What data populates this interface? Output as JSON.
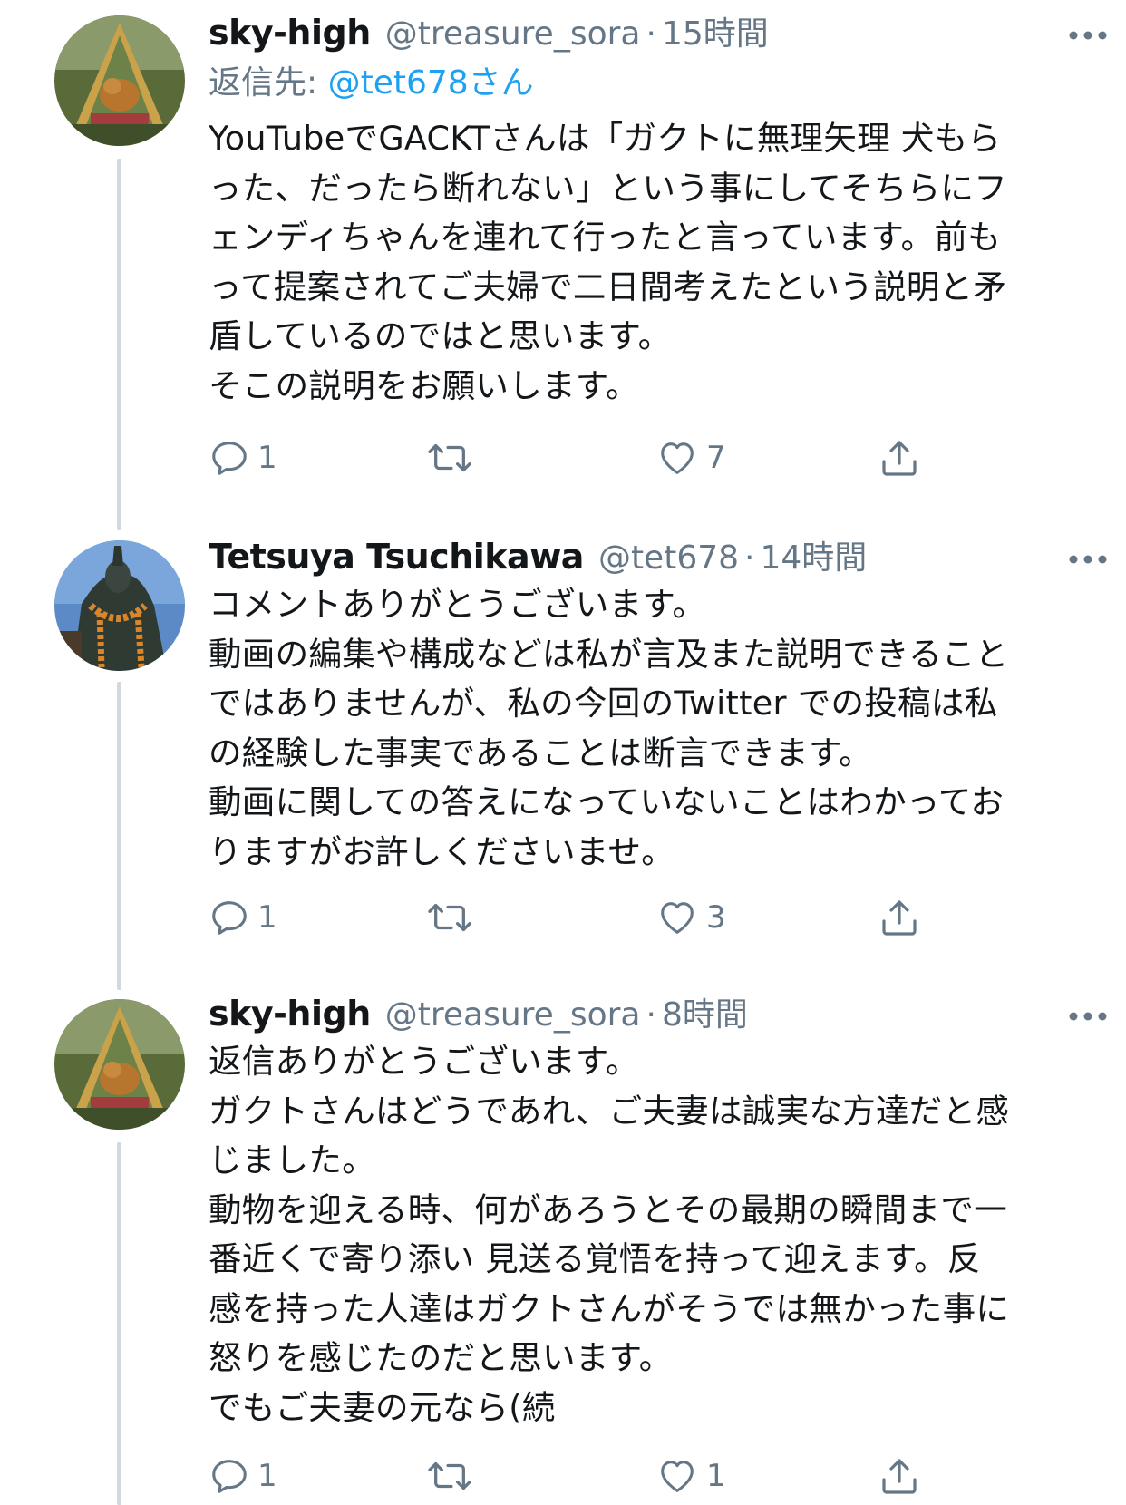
{
  "tweets": [
    {
      "name": "sky-high",
      "handle": "@treasure_sora",
      "separator": "·",
      "time": "15時間",
      "reply_prefix": "返信先: ",
      "reply_mention": "@tet678さん",
      "text": "YouTubeでGACKTさんは「ガクトに無理矢理 犬もら\nった、だったら断れない」という事にしてそちらにフ\nェンディちゃんを連れて行ったと言っています。前も\nって提案されてご夫婦で二日間考えたという説明と矛\n盾しているのではと思います。\nそこの説明をお願いします。",
      "reply_count": "1",
      "retweet_count": "",
      "like_count": "7",
      "avatar_icon": "dog-avatar"
    },
    {
      "name": "Tetsuya Tsuchikawa",
      "handle": "@tet678",
      "separator": "·",
      "time": "14時間",
      "text": "コメントありがとうございます。\n動画の編集や構成などは私が言及また説明できること\nではありませんが、私の今回のTwitter での投稿は私\nの経験した事実であることは断言できます。\n動画に関しての答えになっていないことはわかってお\nりますがお許しくださいませ。",
      "reply_count": "1",
      "retweet_count": "",
      "like_count": "3",
      "avatar_icon": "statue-avatar"
    },
    {
      "name": "sky-high",
      "handle": "@treasure_sora",
      "separator": "·",
      "time": "8時間",
      "text": "返信ありがとうございます。\nガクトさんはどうであれ、ご夫妻は誠実な方達だと感\nじました。\n動物を迎える時、何があろうとその最期の瞬間まで一\n番近くで寄り添い 見送る覚悟を持って迎えます。反\n感を持った人達はガクトさんがそうでは無かった事に\n怒りを感じたのだと思います。\nでもご夫妻の元なら(続",
      "reply_count": "1",
      "retweet_count": "",
      "like_count": "1",
      "avatar_icon": "dog-avatar"
    }
  ],
  "colors": {
    "text": "#14171a",
    "secondary": "#657786",
    "link": "#1da1f2",
    "thread_line": "#cfd9de"
  }
}
